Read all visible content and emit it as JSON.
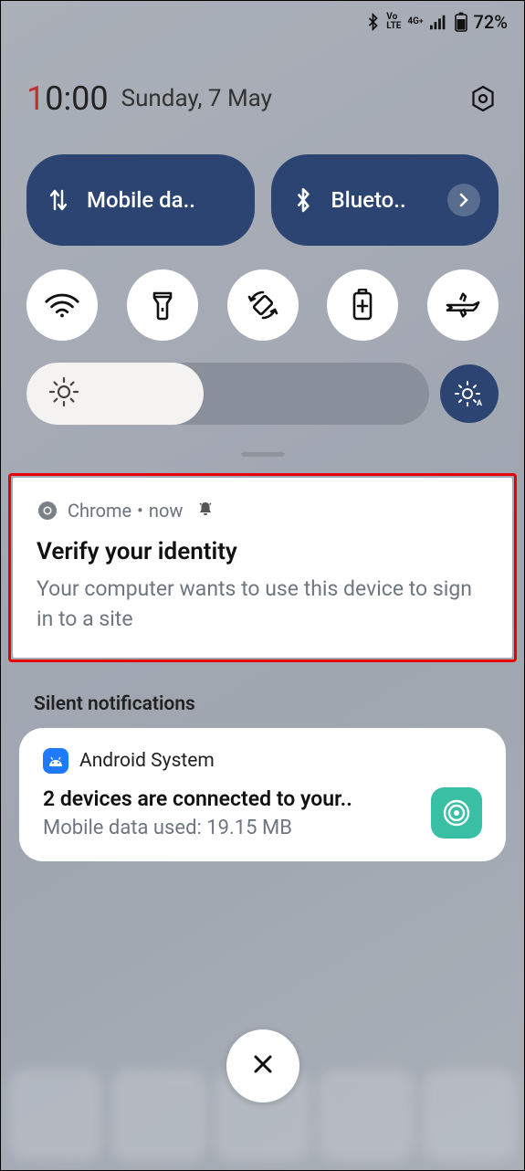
{
  "status_bar": {
    "battery_pct": "72%"
  },
  "clock": {
    "time_red": "1",
    "time_rest": "0:00",
    "date": "Sunday, 7 May"
  },
  "qs_pills": {
    "mobile_data": "Mobile da..",
    "bluetooth": "Blueto.."
  },
  "notif1": {
    "app": "Chrome",
    "sep": " • ",
    "time": "now",
    "title": "Verify your identity",
    "body": "Your computer wants to use this device to sign in to a site"
  },
  "section": {
    "silent_label": "Silent notifications"
  },
  "notif2": {
    "app": "Android System",
    "title": "2 devices are connected to your..",
    "body": "Mobile data used: 19.15 MB"
  }
}
